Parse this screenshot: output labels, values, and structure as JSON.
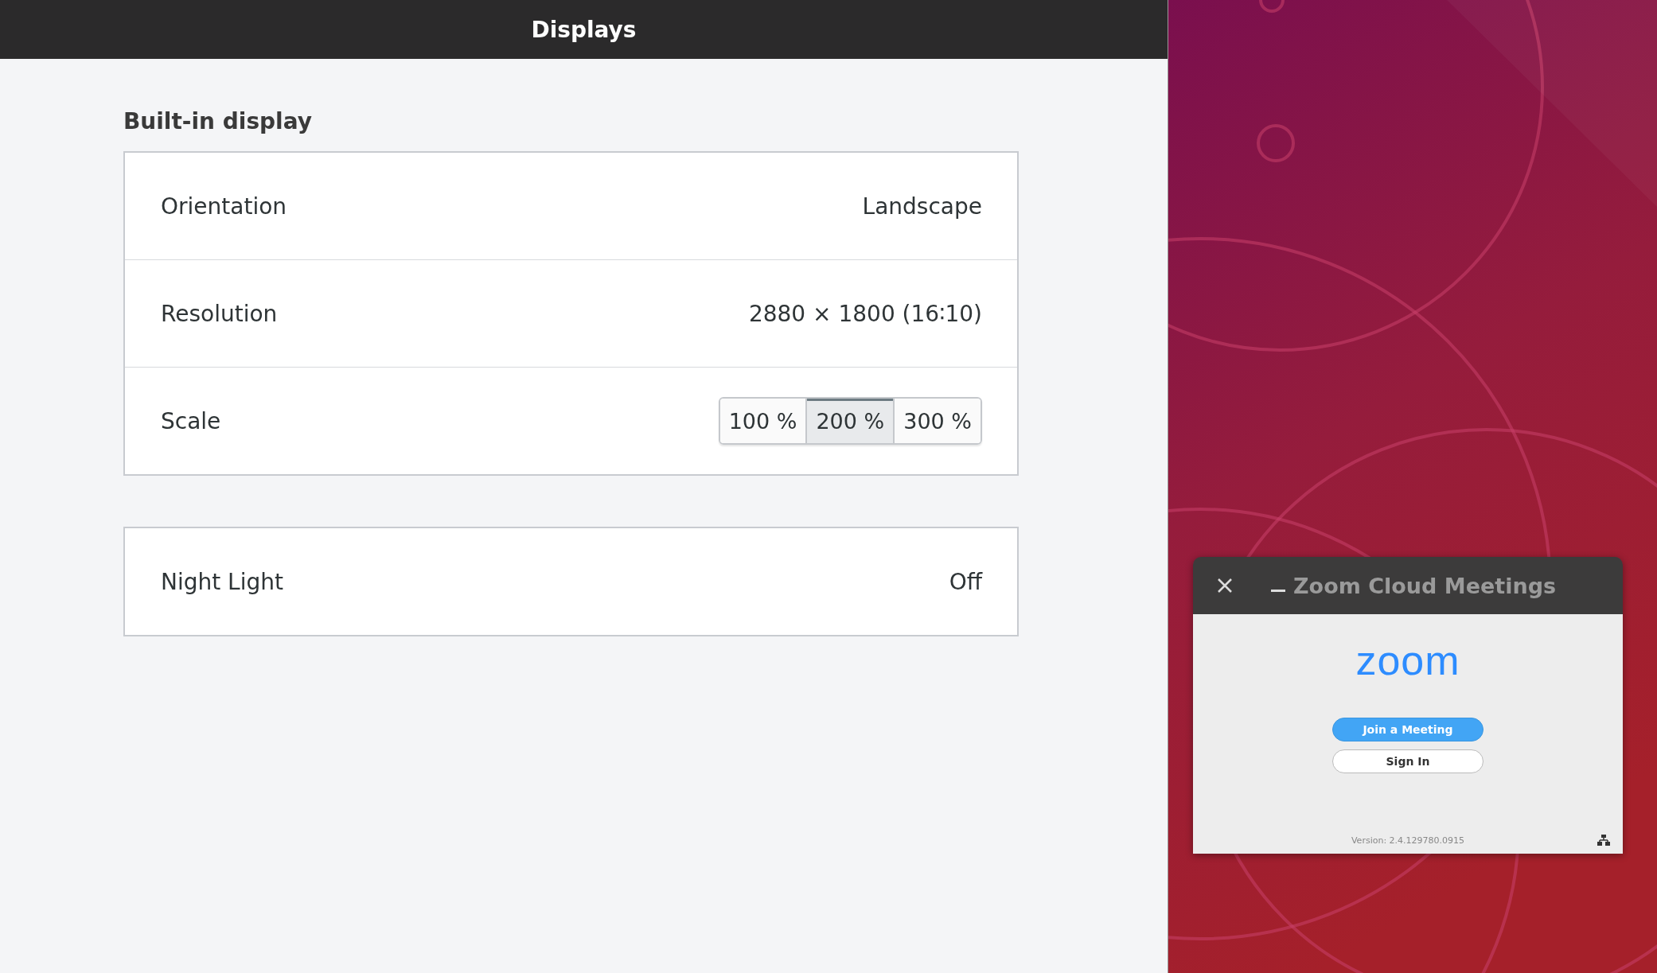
{
  "window": {
    "title": "Displays"
  },
  "section": {
    "title": "Built-in display"
  },
  "rows": [
    {
      "kind": "value",
      "label": "Orientation",
      "value": "Landscape"
    },
    {
      "kind": "value",
      "label": "Resolution",
      "value": "2880 × 1800 (16∶10)"
    },
    {
      "kind": "segments",
      "label": "Scale",
      "options": [
        {
          "label": "100 %",
          "selected": false
        },
        {
          "label": "200 %",
          "selected": true
        },
        {
          "label": "300 %",
          "selected": false
        }
      ]
    }
  ],
  "night_light": {
    "label": "Night Light",
    "value": "Off"
  },
  "zoom_window": {
    "title": "Zoom Cloud Meetings",
    "logo": "zoom",
    "buttons": [
      {
        "kind": "primary",
        "label": "Join a Meeting"
      },
      {
        "kind": "secondary",
        "label": "Sign In"
      }
    ],
    "version": "Version: 2.4.129780.0915"
  }
}
